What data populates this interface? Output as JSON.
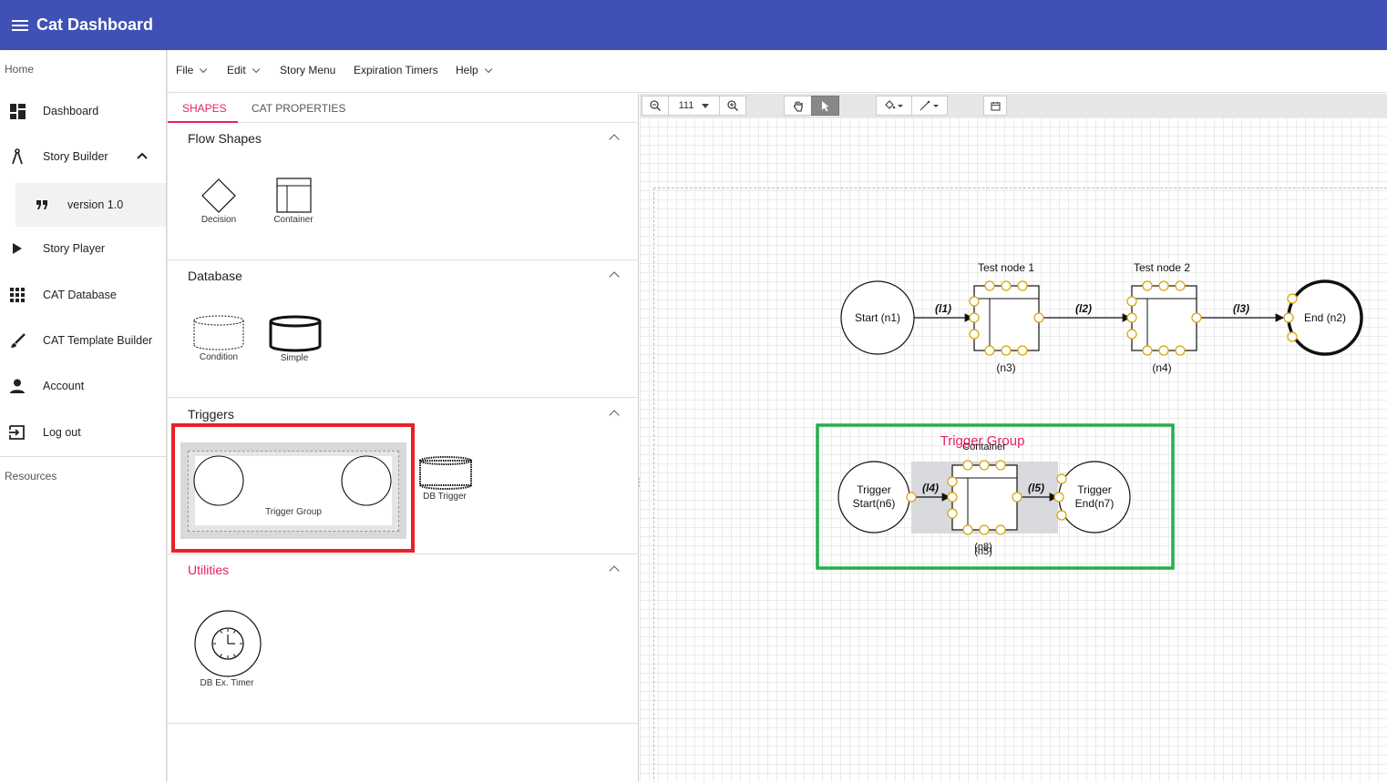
{
  "app": {
    "title": "Cat Dashboard"
  },
  "sidebar": {
    "home_label": "Home",
    "resources_label": "Resources",
    "items": [
      {
        "label": "Dashboard",
        "icon": "dashboard-icon"
      },
      {
        "label": "Story Builder",
        "icon": "compass-icon"
      },
      {
        "label": "version 1.0",
        "icon": "quote-icon"
      },
      {
        "label": "Story Player",
        "icon": "play-icon"
      },
      {
        "label": "CAT Database",
        "icon": "grid-icon"
      },
      {
        "label": "CAT Template Builder",
        "icon": "brush-icon"
      },
      {
        "label": "Account",
        "icon": "person-icon"
      },
      {
        "label": "Log out",
        "icon": "logout-icon"
      }
    ]
  },
  "menubar": {
    "file": "File",
    "edit": "Edit",
    "story_menu": "Story Menu",
    "expiration_timers": "Expiration Timers",
    "help": "Help"
  },
  "panel": {
    "tabs": [
      "SHAPES",
      "CAT PROPERTIES"
    ],
    "sections": {
      "flow": {
        "title": "Flow Shapes",
        "shapes": [
          "Decision",
          "Container"
        ]
      },
      "database": {
        "title": "Database",
        "shapes": [
          "Condition",
          "Simple"
        ]
      },
      "triggers": {
        "title": "Triggers",
        "shapes": [
          "Trigger Group",
          "DB Trigger"
        ]
      },
      "utilities": {
        "title": "Utilities",
        "shapes": [
          "DB Ex. Timer"
        ]
      }
    }
  },
  "toolbar": {
    "zoom": "111"
  },
  "diagram": {
    "nodes": {
      "n1": "Start (n1)",
      "n2": "End (n2)",
      "n3_title": "Test node 1",
      "n3_id": "(n3)",
      "n4_title": "Test node 2",
      "n4_id": "(n4)",
      "n6_line1": "Trigger",
      "n6_line2": "Start(n6)",
      "n7_line1": "Trigger",
      "n7_line2": "End(n7)",
      "n8_title": "Container",
      "n8_id": "(n8)",
      "n5_id": "(n5)"
    },
    "edges": [
      "(l1)",
      "(l2)",
      "(l3)",
      "(l4)",
      "(l5)"
    ],
    "group_title": "Trigger Group"
  },
  "colors": {
    "appbar": "#3f51b5",
    "accent": "#e91e63",
    "highlight_red": "#e82127",
    "highlight_green": "#22b04b",
    "port": "#d9a400"
  }
}
